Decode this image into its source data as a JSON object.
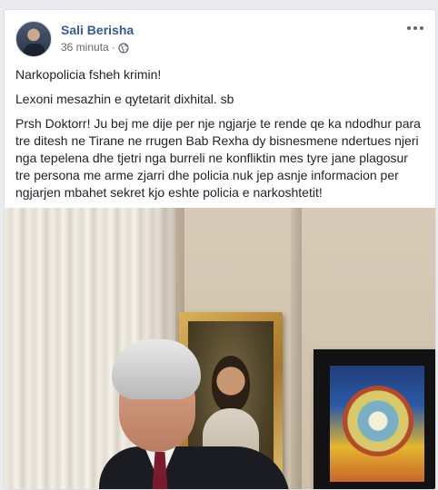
{
  "post": {
    "author_name": "Sali Berisha",
    "timestamp": "36 minuta",
    "separator": "·",
    "privacy_icon": "globe-icon",
    "menu_icon": "more-options-icon",
    "paragraphs": [
      "Narkopolicia fsheh krimin!",
      "Lexoni mesazhin e qytetarit dixhital. sb",
      "Prsh Doktorr! Ju bej me dije per nje ngjarje te rende qe ka ndodhur para tre ditesh ne Tirane ne rrugen Bab Rexha dy bisnesmene ndertues njeri nga tepelena dhe tjetri nga burreli ne konfliktin mes tyre jane plagosur tre persona me arme zjarri dhe policia nuk jep asnje informacion per ngjarjen mbahet sekret kjo eshte policia e narkoshtetit!"
    ]
  },
  "colors": {
    "name_link": "#385898",
    "meta_text": "#606770",
    "body_text": "#1d2129",
    "card_bg": "#ffffff",
    "page_bg": "#e9ebee"
  }
}
